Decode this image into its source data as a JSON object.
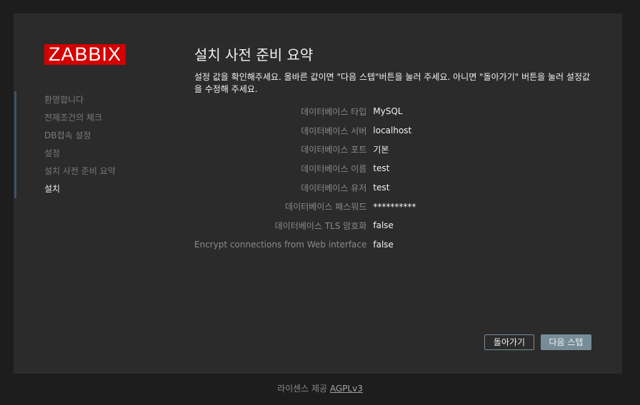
{
  "logo": {
    "text": "ZABBIX",
    "color": "#d40000"
  },
  "steps": [
    {
      "label": "환영합니다",
      "current": false
    },
    {
      "label": "전제조건의 체크",
      "current": false
    },
    {
      "label": "DB접속 설정",
      "current": false
    },
    {
      "label": "설정",
      "current": false
    },
    {
      "label": "설치 사전 준비 요약",
      "current": false
    },
    {
      "label": "설치",
      "current": true
    }
  ],
  "main": {
    "title": "설치 사전 준비 요약",
    "instructions": "설정 값을 확인해주세요. 올바른 값이면 \"다음 스텝\"버튼을 눌러 주세요. 아니면 \"돌아가기\" 버튼을 눌러 설정값을 수정해 주세요.",
    "summary": [
      {
        "label": "데이터베이스 타입",
        "value": "MySQL"
      },
      {
        "label": "데이터베이스 서버",
        "value": "localhost"
      },
      {
        "label": "데이터베이스 포트",
        "value": "기본"
      },
      {
        "label": "데이터베이스 이름",
        "value": "test"
      },
      {
        "label": "데이터베이스 유저",
        "value": "test"
      },
      {
        "label": "데이터베이스 패스워드",
        "value": "**********"
      },
      {
        "label": "데이터베이스 TLS 암호화",
        "value": "false"
      },
      {
        "label": "Encrypt connections from Web interface",
        "value": "false"
      }
    ]
  },
  "buttons": {
    "back_label": "돌아가기",
    "next_label": "다음 스텝"
  },
  "footer": {
    "text": "라이센스 제공",
    "link_label": "AGPLv3"
  },
  "colors": {
    "background": "#1d1d1d",
    "panel": "#2b2b2b",
    "primary_button": "#768d99",
    "step_indicator": "#3d5263"
  }
}
